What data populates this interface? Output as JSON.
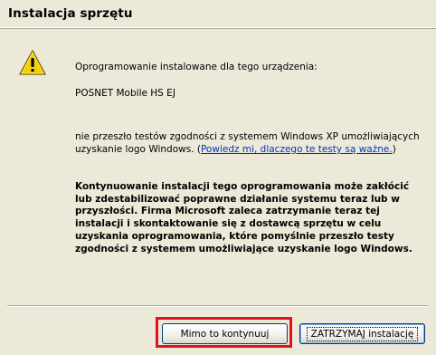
{
  "window": {
    "title": "Instalacja sprzętu"
  },
  "icon": {
    "name": "warning-icon"
  },
  "message": {
    "intro": "Oprogramowanie instalowane dla tego urządzenia:",
    "device": "POSNET Mobile HS EJ",
    "not_passed": "nie przeszło testów zgodności z systemem Windows XP umożliwiających uzyskanie logo Windows. (",
    "link_text": "Powiedz mi, dlaczego te testy są ważne.",
    "link_close": ")",
    "warning_bold": "Kontynuowanie instalacji tego oprogramowania może zakłócić lub zdestabilizować poprawne działanie systemu teraz lub w przyszłości. Firma Microsoft zaleca zatrzymanie teraz tej instalacji i skontaktowanie się z dostawcą sprzętu w celu uzyskania oprogramowania, które pomyślnie przeszło testy zgodności z systemem umożliwiające uzyskanie logo Windows."
  },
  "buttons": {
    "continue_label": "Mimo to kontynuuj",
    "stop_label": "ZATRZYMAJ instalację"
  },
  "colors": {
    "highlight": "#e0131d",
    "link": "#0033cc",
    "background": "#ece9d8"
  }
}
